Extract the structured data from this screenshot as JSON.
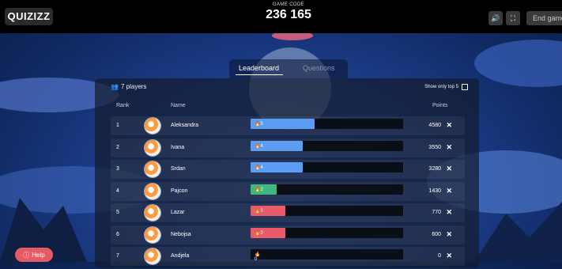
{
  "header": {
    "logo": "QUIZIZZ",
    "game_code_label": "GAME CODE",
    "game_code": "236 165",
    "end_game_label": "End game",
    "sound_icon": "speaker-icon",
    "fullscreen_icon": "fullscreen-icon"
  },
  "tabs": [
    {
      "label": "Leaderboard",
      "active": true
    },
    {
      "label": "Questions",
      "active": false
    }
  ],
  "leaderboard": {
    "players_label": "7 players",
    "show_top_label": "Show only top 5",
    "columns": {
      "rank": "Rank",
      "name": "Name",
      "points": "Points"
    },
    "rows": [
      {
        "rank": "1",
        "name": "Aleksandra",
        "streak": "5",
        "points": "4580",
        "fill": 0.42,
        "color": "#5b9df2"
      },
      {
        "rank": "2",
        "name": "Ivana",
        "streak": "4",
        "points": "3550",
        "fill": 0.34,
        "color": "#5b9df2"
      },
      {
        "rank": "3",
        "name": "Srdan",
        "streak": "4",
        "points": "3280",
        "fill": 0.34,
        "color": "#5b9df2"
      },
      {
        "rank": "4",
        "name": "Pajcon",
        "streak": "2",
        "points": "1430",
        "fill": 0.17,
        "color": "#3fb87c"
      },
      {
        "rank": "5",
        "name": "Lazar",
        "streak": "0",
        "points": "770",
        "fill": 0.23,
        "color": "#ea5a6a"
      },
      {
        "rank": "6",
        "name": "Nebojsa",
        "streak": "0",
        "points": "600",
        "fill": 0.23,
        "color": "#ea5a6a"
      },
      {
        "rank": "7",
        "name": "Andjela",
        "streak": "0",
        "points": "0",
        "fill": 0.0,
        "color": "#ea5a6a"
      }
    ]
  },
  "help_label": "Help",
  "colors": {
    "topbar": "#000000",
    "accent_blue": "#5b9df2",
    "accent_green": "#3fb87c",
    "accent_red": "#ea5a6a",
    "help": "#e65a63"
  }
}
